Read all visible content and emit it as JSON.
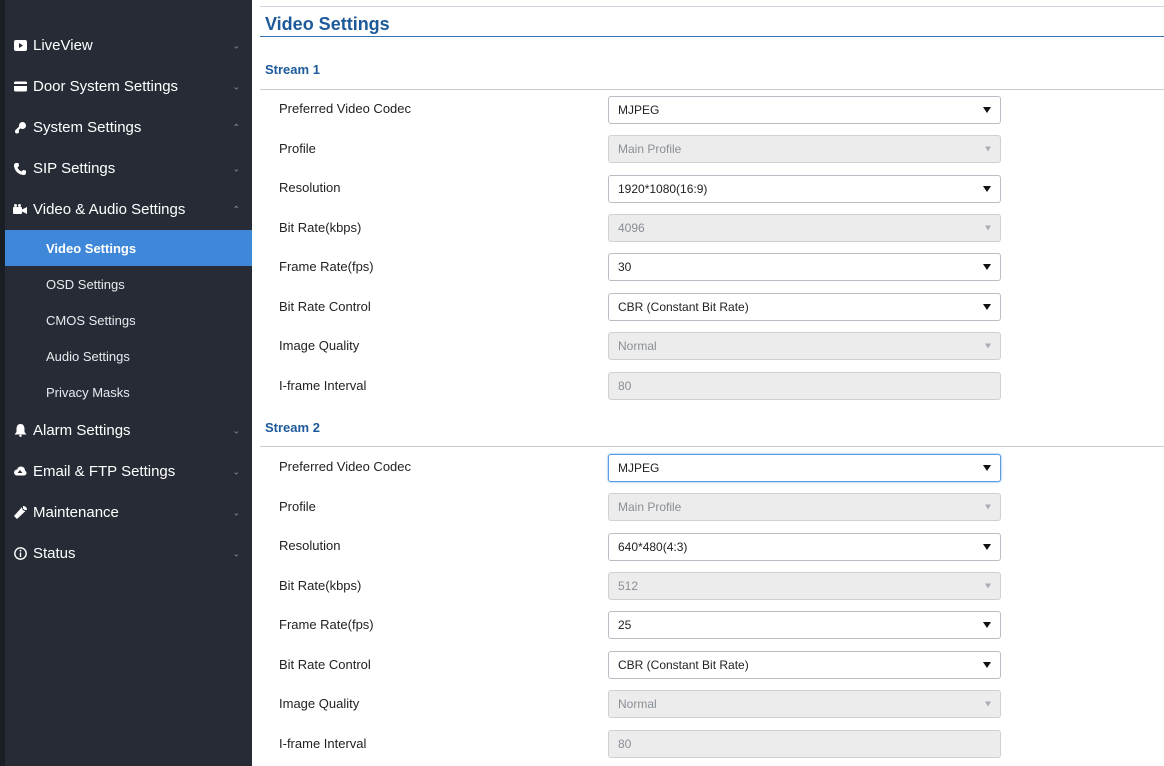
{
  "sidebar": {
    "items": [
      {
        "label": "LiveView",
        "icon": "video-icon",
        "chevron": "down"
      },
      {
        "label": "Door System Settings",
        "icon": "card-icon",
        "chevron": "down"
      },
      {
        "label": "System Settings",
        "icon": "key-icon",
        "chevron": "up"
      },
      {
        "label": "SIP Settings",
        "icon": "phone-icon",
        "chevron": "down"
      },
      {
        "label": "Video & Audio Settings",
        "icon": "camera-icon",
        "chevron": "up"
      }
    ],
    "sub_items": [
      {
        "label": "Video Settings",
        "active": true
      },
      {
        "label": "OSD Settings",
        "active": false
      },
      {
        "label": "CMOS Settings",
        "active": false
      },
      {
        "label": "Audio Settings",
        "active": false
      },
      {
        "label": "Privacy Masks",
        "active": false
      }
    ],
    "items_after": [
      {
        "label": "Alarm Settings",
        "icon": "bell-icon",
        "chevron": "down"
      },
      {
        "label": "Email & FTP Settings",
        "icon": "cloud-icon",
        "chevron": "down"
      },
      {
        "label": "Maintenance",
        "icon": "wrench-icon",
        "chevron": "down"
      },
      {
        "label": "Status",
        "icon": "info-icon",
        "chevron": "down"
      }
    ],
    "colors": {
      "background": "#262b35",
      "active": "#3f88d9"
    }
  },
  "page": {
    "title": "Video Settings",
    "accent": "#1d5a9a"
  },
  "stream1": {
    "title": "Stream 1",
    "codec": {
      "label": "Preferred Video Codec",
      "value": "MJPEG"
    },
    "profile": {
      "label": "Profile",
      "value": "Main Profile"
    },
    "resolution": {
      "label": "Resolution",
      "value": "1920*1080(16:9)"
    },
    "bitrate": {
      "label": "Bit Rate(kbps)",
      "value": "4096"
    },
    "framerate": {
      "label": "Frame Rate(fps)",
      "value": "30"
    },
    "bitrate_control": {
      "label": "Bit Rate Control",
      "value": "CBR (Constant Bit Rate)"
    },
    "image_quality": {
      "label": "Image Quality",
      "value": "Normal"
    },
    "iframe": {
      "label": "I-frame Interval",
      "value": "80"
    }
  },
  "stream2": {
    "title": "Stream 2",
    "codec": {
      "label": "Preferred Video Codec",
      "value": "MJPEG"
    },
    "profile": {
      "label": "Profile",
      "value": "Main Profile"
    },
    "resolution": {
      "label": "Resolution",
      "value": "640*480(4:3)"
    },
    "bitrate": {
      "label": "Bit Rate(kbps)",
      "value": "512"
    },
    "framerate": {
      "label": "Frame Rate(fps)",
      "value": "25"
    },
    "bitrate_control": {
      "label": "Bit Rate Control",
      "value": "CBR (Constant Bit Rate)"
    },
    "image_quality": {
      "label": "Image Quality",
      "value": "Normal"
    },
    "iframe": {
      "label": "I-frame Interval",
      "value": "80"
    }
  }
}
